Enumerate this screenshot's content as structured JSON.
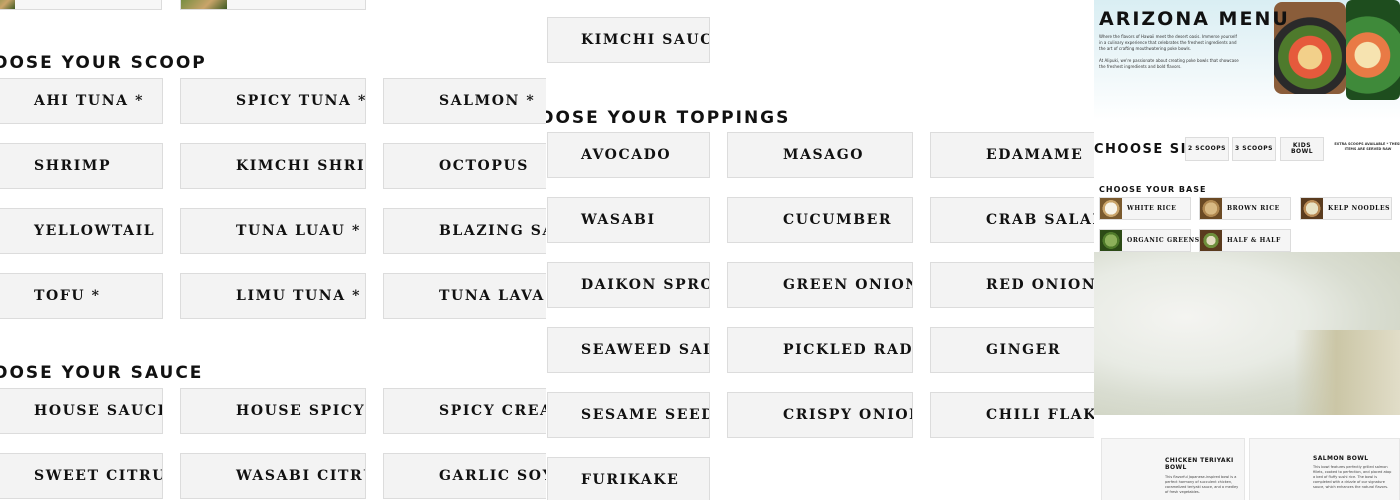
{
  "scoop": {
    "heading": "OOSE YOUR SCOOP",
    "items": [
      "AHI TUNA *",
      "SPICY TUNA *",
      "SALMON *",
      "SHRIMP",
      "KIMCHI SHRIMP",
      "OCTOPUS",
      "YELLOWTAIL *",
      "TUNA LUAU *",
      "BLAZING SALMON",
      "TOFU *",
      "LIMU TUNA *",
      "TUNA LAVA *"
    ]
  },
  "sauce": {
    "heading": "OOSE YOUR SAUCE",
    "items": [
      "HOUSE SAUCE",
      "HOUSE SPICY",
      "SPICY CREAMY",
      "SWEET CITRUS",
      "WASABI CITRUS",
      "GARLIC SOY MIRIN"
    ],
    "kimchi": "KIMCHI SAUCE"
  },
  "toppings": {
    "heading": "OOSE YOUR TOPPINGS",
    "items": [
      "AVOCADO",
      "MASAGO",
      "EDAMAME",
      "WASABI",
      "CUCUMBER",
      "CRAB SALAD",
      "DAIKON SPROUT",
      "GREEN ONION",
      "RED ONION",
      "SEAWEED SALAD",
      "PICKLED RADISH",
      "GINGER",
      "SESAME SEED",
      "CRISPY ONION",
      "CHILI FLAKES",
      "FURIKAKE"
    ]
  },
  "arizona": {
    "title": "ARIZONA MENU",
    "para1": "Where the flavors of Hawaii meet the desert oasis. Immerse yourself in a culinary experience that celebrates the freshest ingredients and the art of crafting mouthwatering poke bowls.",
    "para2": "At Alipuki, we're passionate about creating poke bowls that showcase the freshest ingredients and bold flavors."
  },
  "size": {
    "label": "CHOOSE SIZE",
    "options": [
      "2 SCOOPS",
      "3 SCOOPS",
      "KIDS BOWL"
    ],
    "note": "EXTRA SCOOPS AVAILABLE * THESE ITEMS ARE SERVED RAW"
  },
  "base": {
    "label": "CHOOSE YOUR BASE",
    "options": [
      "WHITE RICE",
      "BROWN RICE",
      "KELP NOODLES",
      "ORGANIC GREENS",
      "HALF & HALF"
    ]
  },
  "bowls": [
    {
      "name": "CHICKEN TERIYAKI BOWL",
      "desc": "This flavorful Japanese-inspired bowl is a perfect harmony of succulent chicken, caramelized teriyaki sauce, and a medley of fresh vegetables."
    },
    {
      "name": "SALMON BOWL",
      "desc": "This bowl features perfectly grilled salmon fillets, cooked to perfection, and placed atop a bed of fluffy sushi rice. The bowl is completed with a drizzle of our signature sauce, which enhances the natural flavors."
    }
  ],
  "colors": {
    "card_bg": "#f3f3f3",
    "card_border": "#dcdcdc",
    "text": "#111111"
  }
}
